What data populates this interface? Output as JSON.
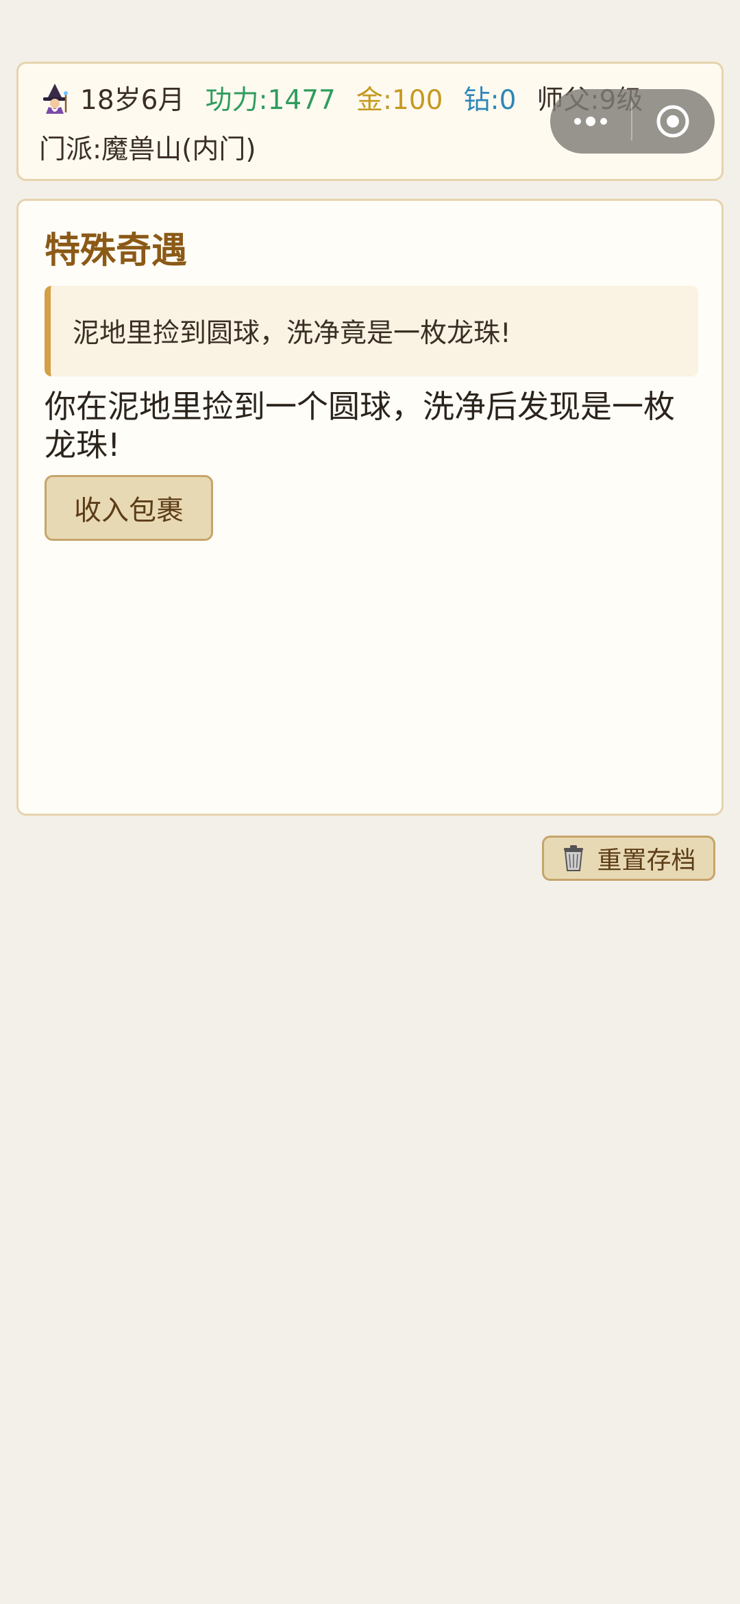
{
  "status": {
    "avatar_icon": "wizard-icon",
    "age": "18岁6月",
    "power": "功力:1477",
    "gold": "金:100",
    "diamond": "钻:0",
    "master": "师父:9级",
    "sect": "门派:魔兽山(内门)",
    "colors": {
      "power": "#2f9c5e",
      "gold": "#c49a21",
      "diamond": "#2e86b8"
    }
  },
  "capsule": {
    "more_icon": "more-dots-icon",
    "close_icon": "target-close-icon"
  },
  "event": {
    "title": "特殊奇遇",
    "quote": "泥地里捡到圆球，洗净竟是一枚龙珠!",
    "description": "你在泥地里捡到一个圆球，洗净后发现是一枚龙珠!",
    "collect_button": "收入包裹",
    "title_color": "#8b5a17"
  },
  "footer": {
    "reset_icon": "trash-can-icon",
    "reset_label": "重置存档"
  }
}
